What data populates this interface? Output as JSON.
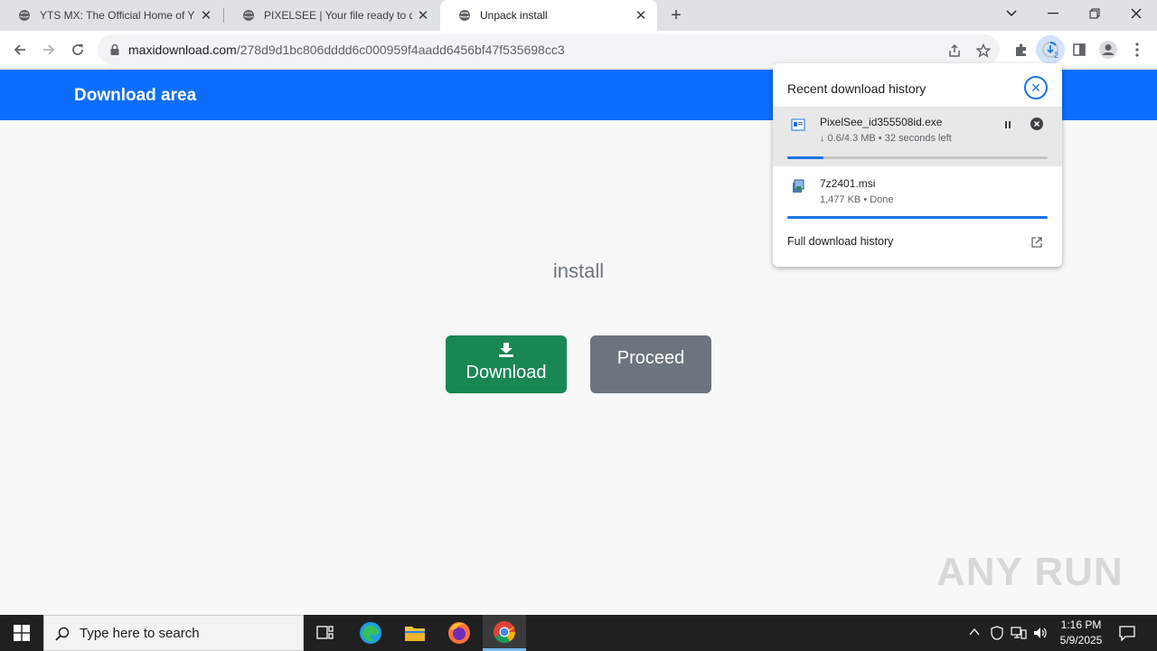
{
  "browser": {
    "tabs": [
      {
        "title": "YTS MX: The Official Home of YIFY"
      },
      {
        "title": "PIXELSEE | Your file ready to download"
      },
      {
        "title": "Unpack install"
      }
    ],
    "url_host": "maxidownload.com",
    "url_path": "/278d9d1bc806dddd6c000959f4aadd6456bf47f535698cc3",
    "download_badge": "2"
  },
  "page": {
    "header_title": "Download area",
    "subtitle": "install",
    "download_label": "Download",
    "proceed_label": "Proceed"
  },
  "downloads": {
    "title": "Recent download history",
    "items": [
      {
        "name": "PixelSee_id355508id.exe",
        "status": "↓ 0.6/4.3 MB • 32 seconds left",
        "progress": 0.14
      },
      {
        "name": "7z2401.msi",
        "status": "1,477 KB • Done",
        "progress": 1.0
      }
    ],
    "full_history": "Full download history"
  },
  "taskbar": {
    "search_placeholder": "Type here to search",
    "time": "1:16 PM",
    "date": "5/9/2025"
  },
  "watermark": "ANY RUN",
  "colors": {
    "header_blue": "#0d6efd",
    "download_green": "#198754",
    "proceed_gray": "#6c757d",
    "accent": "#1a73e8"
  }
}
